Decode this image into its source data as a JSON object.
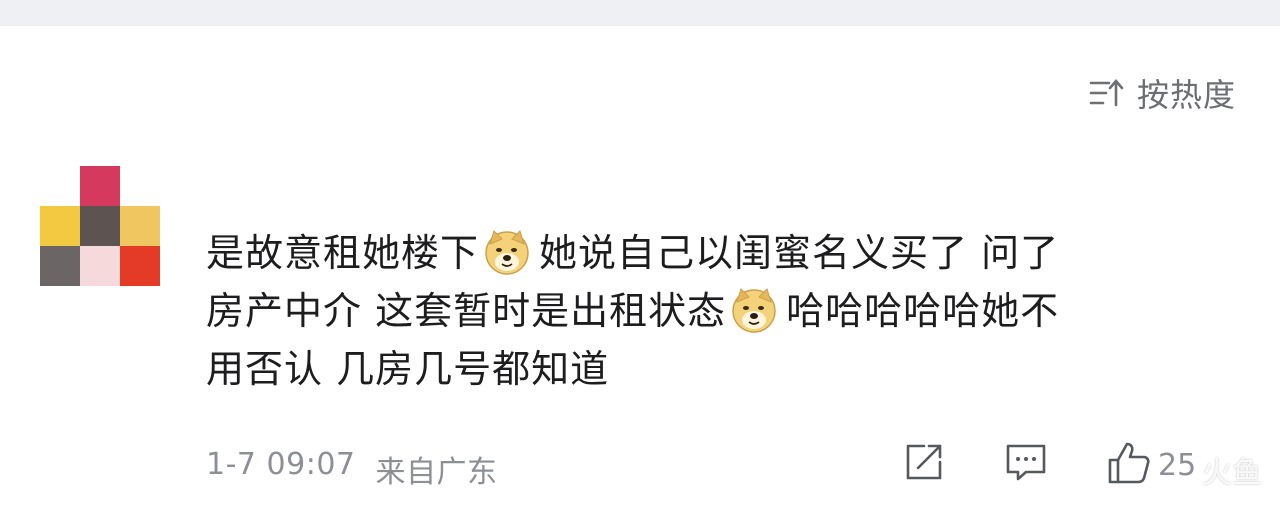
{
  "sort": {
    "label": "按热度",
    "icon": "sort-icon"
  },
  "avatar": {
    "icon": "pixel-avatar",
    "colors": [
      "#d6395e",
      "#f2c940",
      "#5d5350",
      "#f0c660",
      "#6b6665",
      "#f6dadb",
      "#e33b26"
    ]
  },
  "comment": {
    "line1_a": "是故意租她楼下",
    "line1_b": "她说自己以闺蜜名义买了 问了",
    "line2_a": "房产中介 这套暂时是出租状态",
    "line2_b": "哈哈哈哈哈她不",
    "line3": "用否认 几房几号都知道",
    "emoji": "doge-emoji"
  },
  "meta": {
    "time": "1-7 09:07",
    "location": "来自广东"
  },
  "actions": {
    "share_icon": "share-icon",
    "comment_icon": "comment-icon",
    "like_icon": "like-icon",
    "like_count": "25"
  },
  "watermark": "火鱼"
}
